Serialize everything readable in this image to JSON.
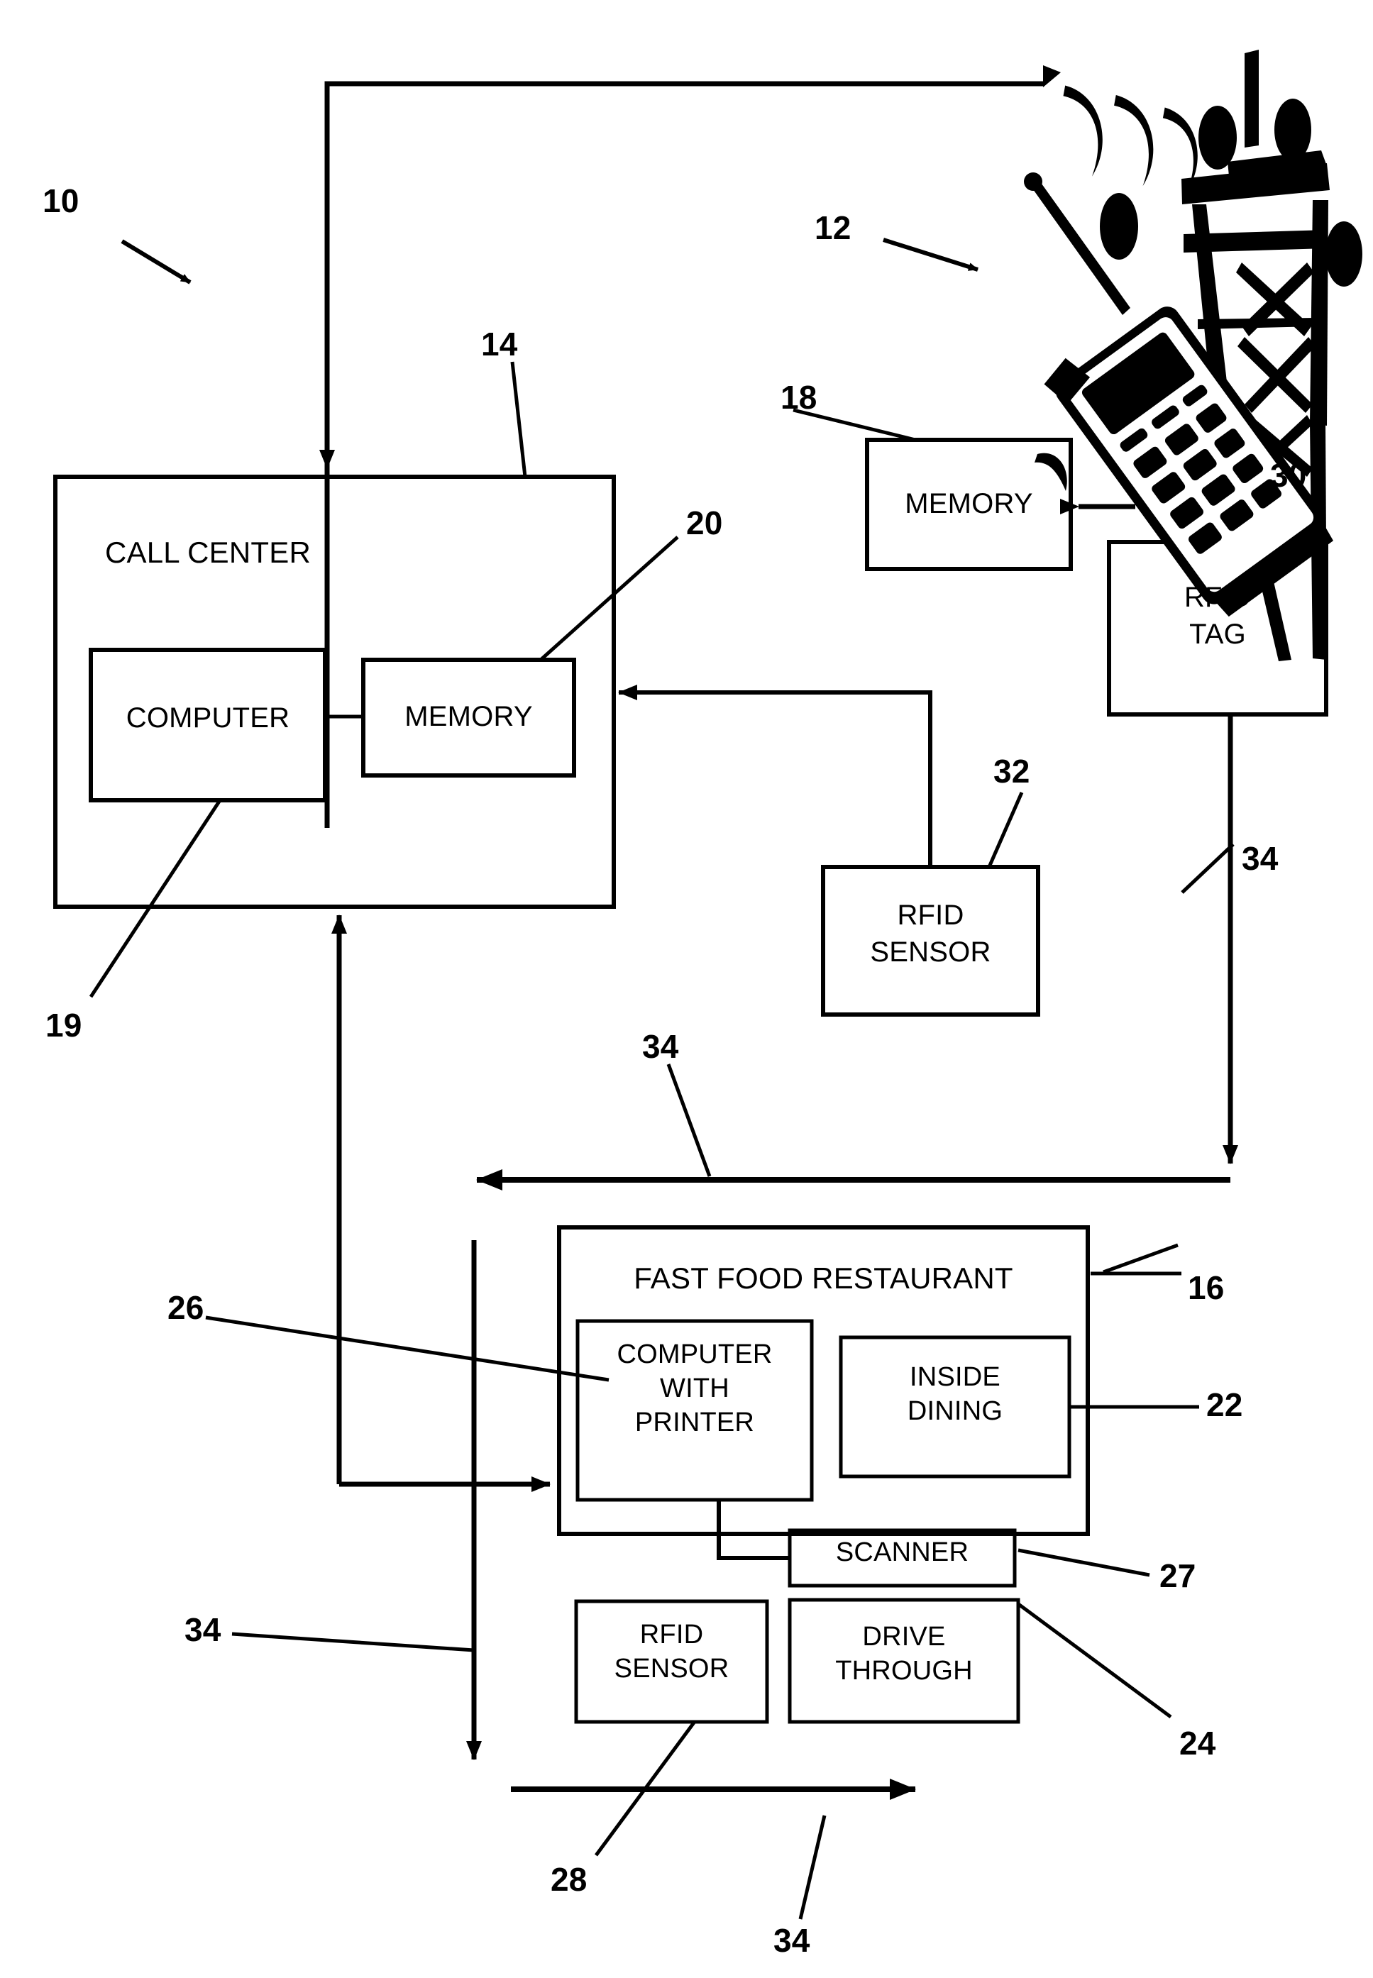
{
  "figure": {
    "kind": "patent-system-diagram",
    "background_color": "#ffffff",
    "line_color": "#000000"
  },
  "boxes": {
    "call_center": {
      "label": "CALL CENTER",
      "ref": "14"
    },
    "call_center_computer": {
      "label": "COMPUTER",
      "ref": "19"
    },
    "call_center_memory": {
      "label": "MEMORY",
      "ref": "20"
    },
    "mobile_memory": {
      "label": "MEMORY",
      "ref": "18"
    },
    "rfid_tag": {
      "line1": "RFID",
      "line2": "TAG",
      "ref": "30"
    },
    "rfid_sensor_remote": {
      "line1": "RFID",
      "line2": "SENSOR",
      "ref": "32"
    },
    "restaurant": {
      "label": "FAST FOOD RESTAURANT",
      "ref": "16"
    },
    "restaurant_computer": {
      "line1": "COMPUTER",
      "line2": "WITH",
      "line3": "PRINTER",
      "ref": "26"
    },
    "inside_dining": {
      "line1": "INSIDE",
      "line2": "DINING",
      "ref": "22"
    },
    "scanner": {
      "label": "SCANNER",
      "ref": "27"
    },
    "restaurant_rfid_sensor": {
      "line1": "RFID",
      "line2": "SENSOR",
      "ref": "28"
    },
    "drive_through": {
      "line1": "DRIVE",
      "line2": "THROUGH",
      "ref": "24"
    }
  },
  "illustration": {
    "mobile_phone": "cell-phone-with-antenna",
    "cell_tower": "radio-tower",
    "signal_waves": "rf-signal-waves",
    "ref": "12"
  },
  "reference_numerals": {
    "system": "10",
    "mobile_unit": "12",
    "call_center": "14",
    "restaurant": "16",
    "mobile_memory": "18",
    "call_center_computer": "19",
    "call_center_memory": "20",
    "inside_dining": "22",
    "drive_through": "24",
    "restaurant_computer": "26",
    "scanner": "27",
    "restaurant_rfid_sensor": "28",
    "rfid_tag": "30",
    "rfid_sensor_remote": "32",
    "communication_link_a": "34",
    "communication_link_b": "34",
    "communication_link_c": "34",
    "communication_link_d": "34"
  }
}
